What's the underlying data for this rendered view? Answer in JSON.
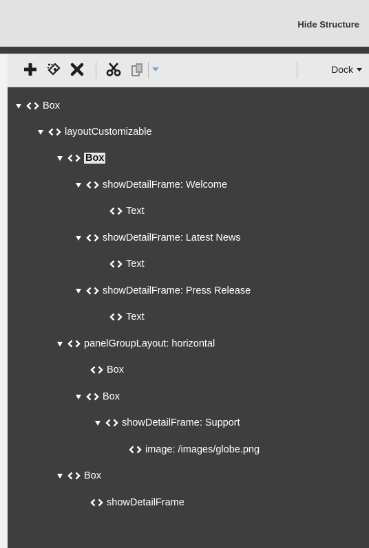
{
  "header": {
    "hide_structure_label": "Hide Structure"
  },
  "toolbar": {
    "icons": [
      "add-icon",
      "edit-icon",
      "delete-icon",
      "cut-icon",
      "paste-icon",
      "dropdown-caret-icon"
    ],
    "dock_label": "Dock"
  },
  "tree": {
    "nodes": [
      {
        "label": "Box",
        "depth": 0,
        "expanded": true
      },
      {
        "label": "layoutCustomizable",
        "depth": 1,
        "expanded": true
      },
      {
        "label": "Box",
        "depth": 2,
        "expanded": true,
        "selected": true
      },
      {
        "label": "showDetailFrame: Welcome",
        "depth": 3,
        "expanded": true
      },
      {
        "label": "Text",
        "depth": 4,
        "expanded": false
      },
      {
        "label": "showDetailFrame: Latest News",
        "depth": 3,
        "expanded": true
      },
      {
        "label": "Text",
        "depth": 4,
        "expanded": false
      },
      {
        "label": "showDetailFrame: Press Release",
        "depth": 3,
        "expanded": true
      },
      {
        "label": "Text",
        "depth": 4,
        "expanded": false
      },
      {
        "label": "panelGroupLayout: horizontal",
        "depth": 2,
        "expanded": true
      },
      {
        "label": "Box",
        "depth": 3,
        "expanded": false
      },
      {
        "label": "Box",
        "depth": 3,
        "expanded": true
      },
      {
        "label": "showDetailFrame: Support",
        "depth": 4,
        "expanded": true
      },
      {
        "label": "image: /images/globe.png",
        "depth": 5,
        "expanded": false
      },
      {
        "label": "Box",
        "depth": 2,
        "expanded": true
      },
      {
        "label": "showDetailFrame",
        "depth": 3,
        "expanded": false
      }
    ]
  }
}
